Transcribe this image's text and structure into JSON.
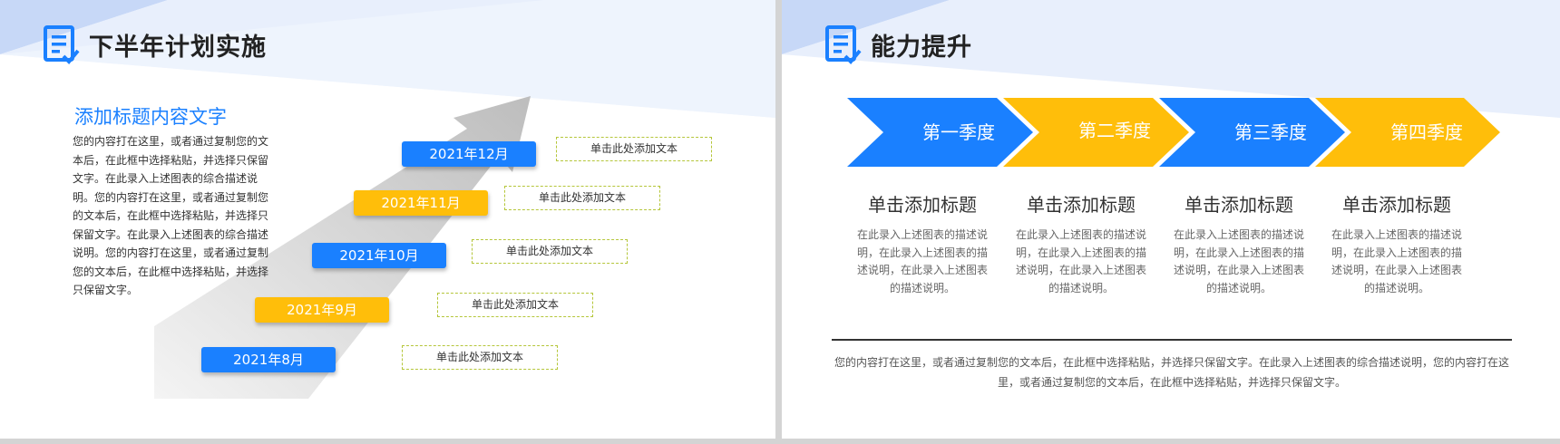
{
  "colors": {
    "accent_blue": "#1a80ff",
    "accent_gold": "#ffbe0a",
    "bg_light_blue": "#dbe6fb"
  },
  "left_slide": {
    "title": "下半年计划实施",
    "title_icon": "document-list-icon",
    "sub_heading": "添加标题内容文字",
    "body_text": "您的内容打在这里，或者通过复制您的文本后，在此框中选择粘贴，并选择只保留文字。在此录入上述图表的综合描述说明。您的内容打在这里，或者通过复制您的文本后，在此框中选择粘贴，并选择只保留文字。在此录入上述图表的综合描述说明。您的内容打在这里，或者通过复制您的文本后，在此框中选择粘贴，并选择只保留文字。",
    "milestones": [
      {
        "month": "2021年12月",
        "color": "blue",
        "note": "单击此处添加文本"
      },
      {
        "month": "2021年11月",
        "color": "gold",
        "note": "单击此处添加文本"
      },
      {
        "month": "2021年10月",
        "color": "blue",
        "note": "单击此处添加文本"
      },
      {
        "month": "2021年9月",
        "color": "gold",
        "note": "单击此处添加文本"
      },
      {
        "month": "2021年8月",
        "color": "blue",
        "note": "单击此处添加文本"
      }
    ]
  },
  "right_slide": {
    "title": "能力提升",
    "title_icon": "document-list-icon",
    "quarters": [
      {
        "label": "第一季度",
        "color": "blue",
        "heading": "单击添加标题",
        "desc": "在此录入上述图表的描述说明，在此录入上述图表的描述说明，在此录入上述图表的描述说明。"
      },
      {
        "label": "第二季度",
        "color": "gold",
        "heading": "单击添加标题",
        "desc": "在此录入上述图表的描述说明，在此录入上述图表的描述说明，在此录入上述图表的描述说明。"
      },
      {
        "label": "第三季度",
        "color": "blue",
        "heading": "单击添加标题",
        "desc": "在此录入上述图表的描述说明，在此录入上述图表的描述说明，在此录入上述图表的描述说明。"
      },
      {
        "label": "第四季度",
        "color": "gold",
        "heading": "单击添加标题",
        "desc": "在此录入上述图表的描述说明，在此录入上述图表的描述说明，在此录入上述图表的描述说明。"
      }
    ],
    "footer_text": "您的内容打在这里，或者通过复制您的文本后，在此框中选择粘贴，并选择只保留文字。在此录入上述图表的综合描述说明，您的内容打在这里，或者通过复制您的文本后，在此框中选择粘贴，并选择只保留文字。"
  }
}
